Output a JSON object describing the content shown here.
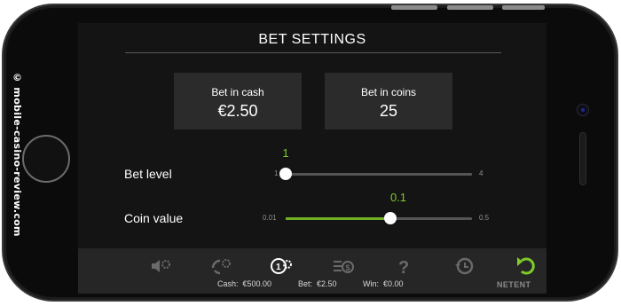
{
  "watermark": "© mobile-casino-review.com",
  "screen": {
    "title": "BET SETTINGS",
    "bet_in_cash": {
      "label": "Bet in cash",
      "value": "€2.50"
    },
    "bet_in_coins": {
      "label": "Bet in coins",
      "value": "25"
    },
    "bet_level": {
      "label": "Bet level",
      "value": "1",
      "min": "1",
      "max": "4",
      "fraction": 0
    },
    "coin_value": {
      "label": "Coin value",
      "value": "0.1",
      "min": "0.01",
      "max": "0.5",
      "fraction": 0.56
    },
    "toolbar": {
      "icons": [
        "sound-settings-icon",
        "autoplay-settings-icon",
        "coin-settings-icon",
        "bet-settings-icon",
        "help-icon",
        "history-icon",
        "back-icon"
      ],
      "cash_label": "Cash:",
      "cash_value": "€500.00",
      "bet_label": "Bet:",
      "bet_value": "€2.50",
      "win_label": "Win:",
      "win_value": "€0.00",
      "brand": "NETENT"
    }
  },
  "colors": {
    "accent": "#7fcb2a",
    "track": "#555555",
    "box": "#2b2b2b",
    "screen_bg": "#141414",
    "toolbar_bg": "#262626"
  }
}
